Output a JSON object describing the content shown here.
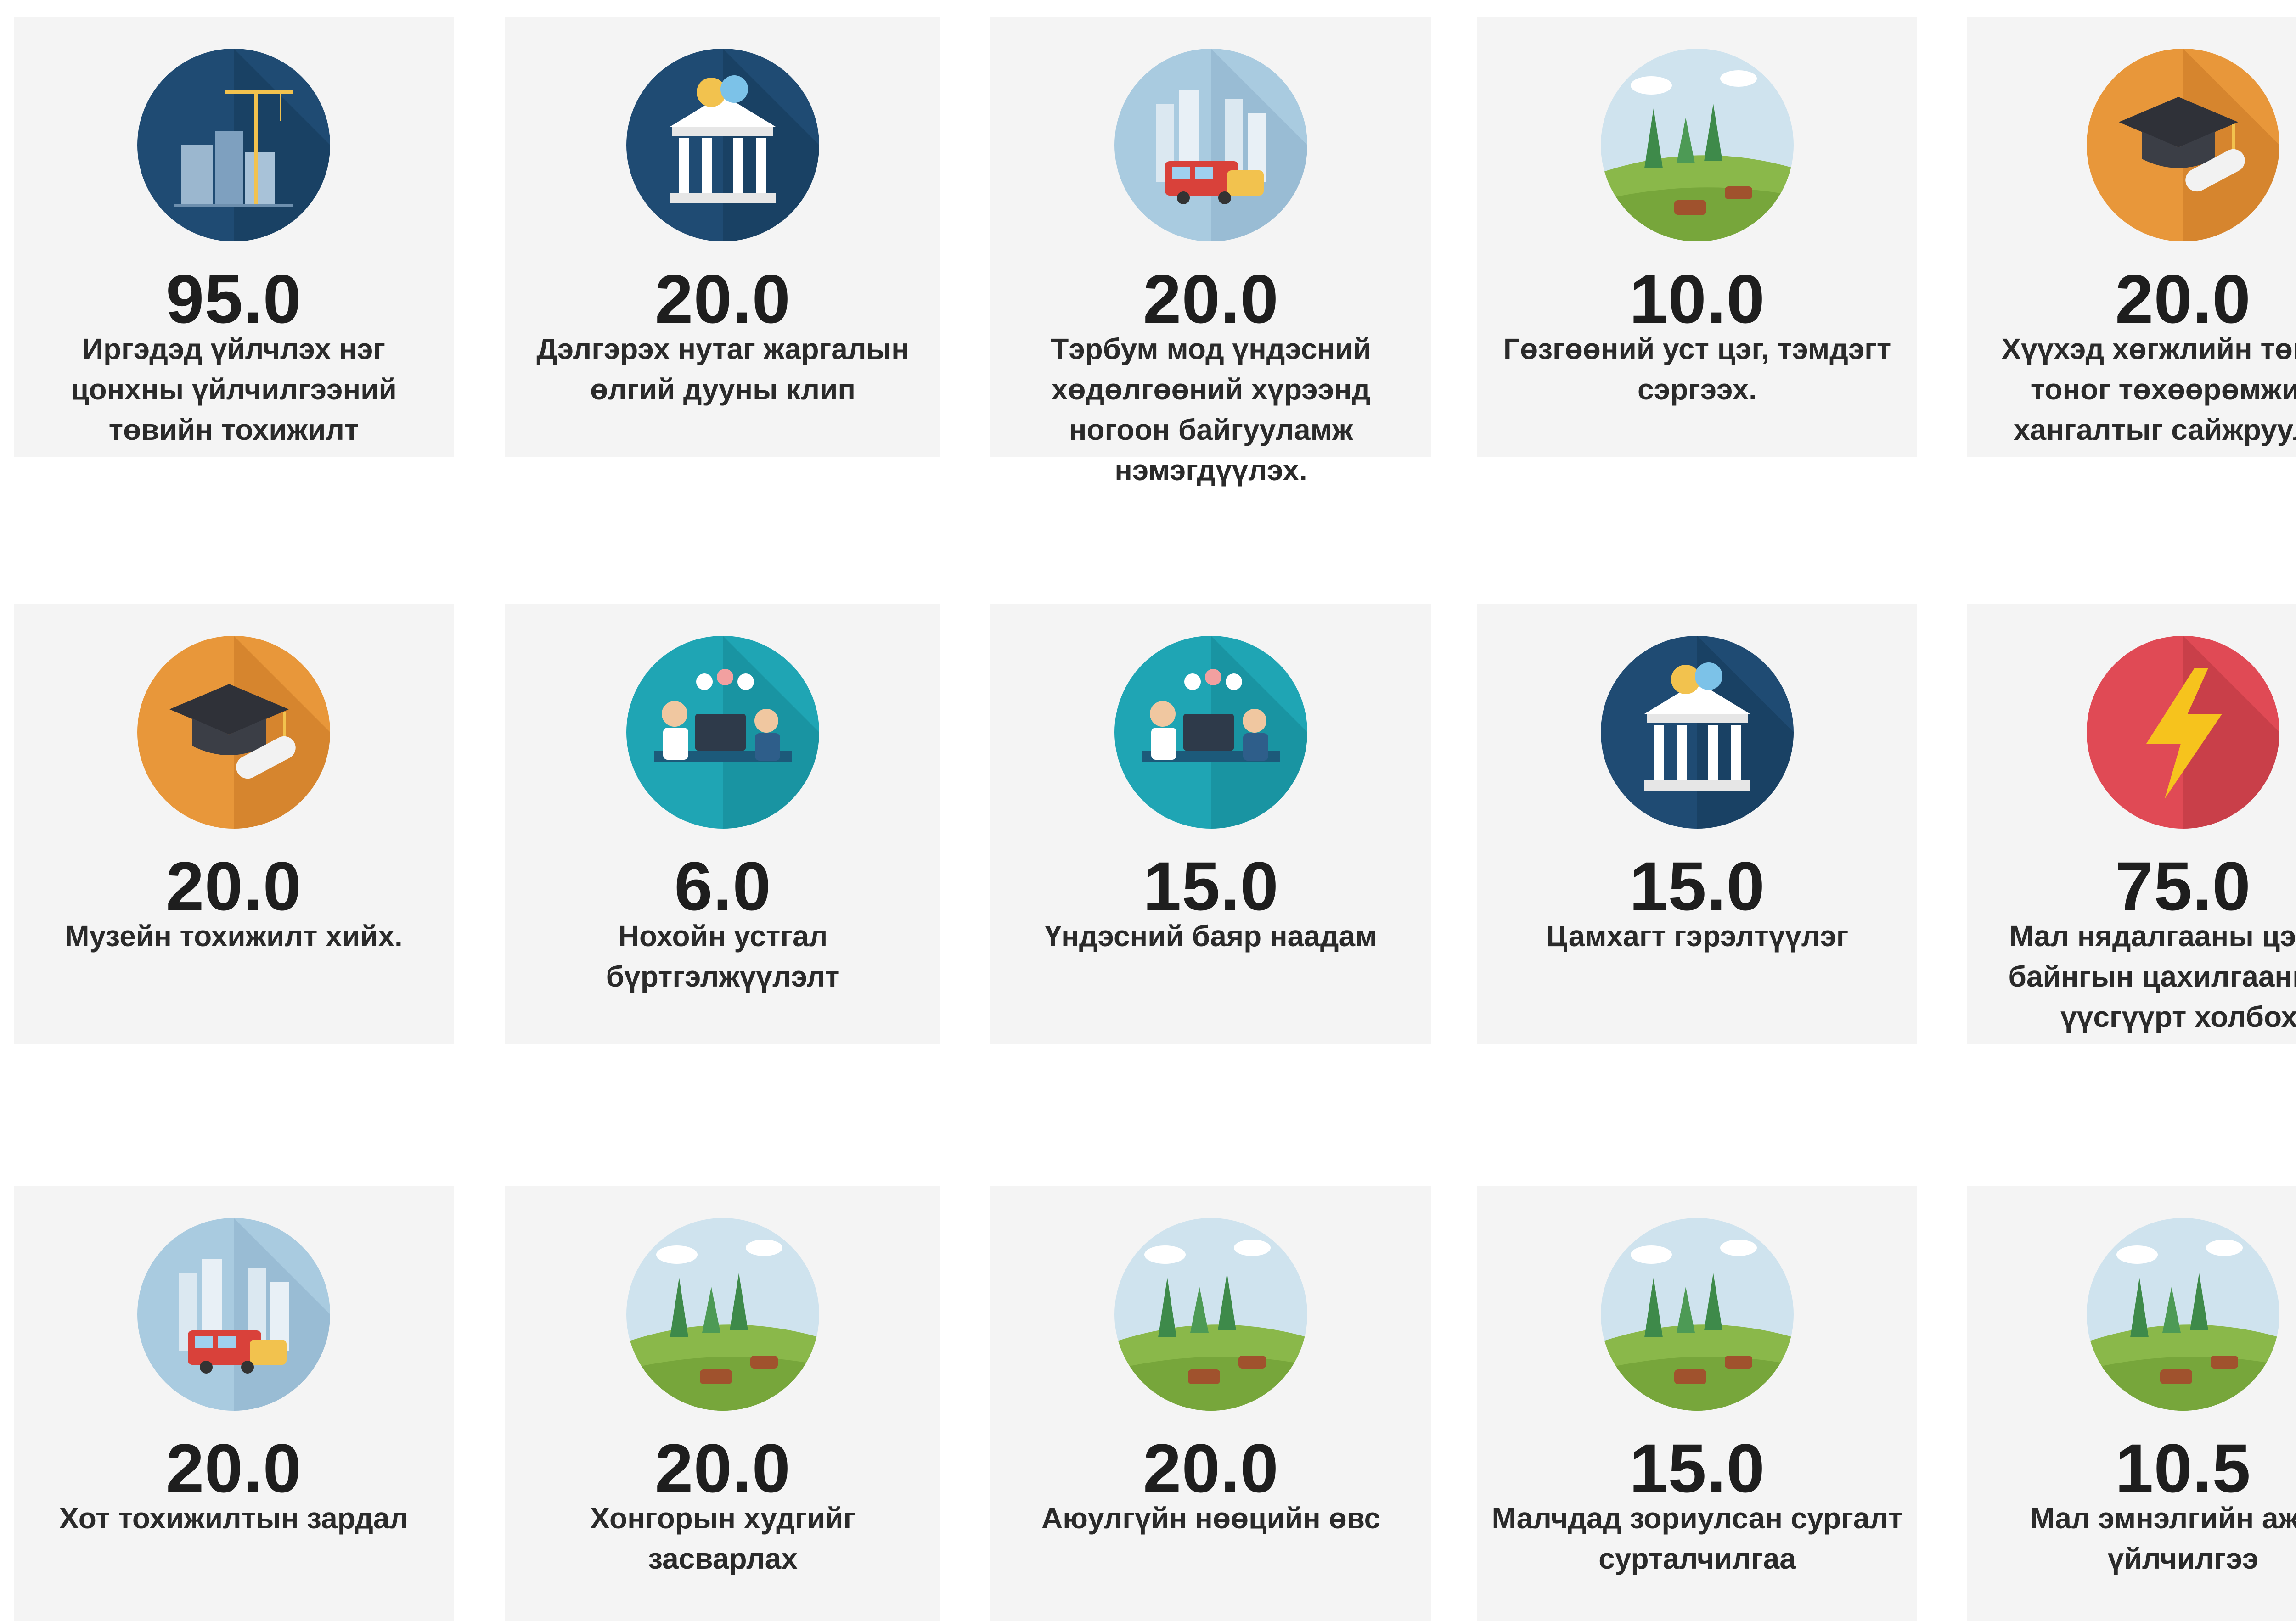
{
  "cards": [
    {
      "value": "95.0",
      "label": "Иргэдэд үйлчлэх нэг цонхны үйлчилгээний төвийн тохижилт",
      "icon": "construction-icon",
      "color": "#1f4b73"
    },
    {
      "value": "20.0",
      "label": "Дэлгэрэх нутаг жаргалын өлгий дууны клип",
      "icon": "theater-building-icon",
      "color": "#1f4b73"
    },
    {
      "value": "20.0",
      "label": "Тэрбум мод үндэсний хөдөлгөөний хүрээнд ногоон байгууламж нэмэгдүүлэх.",
      "icon": "city-transport-icon",
      "color": "#a9cbe0"
    },
    {
      "value": "10.0",
      "label": "Гөзгөөний уст цэг, тэмдэгт сэргээх.",
      "icon": "pasture-livestock-icon",
      "color": "#cfe3ee"
    },
    {
      "value": "20.0",
      "label": "Хүүхэд хөгжлийн төвийн тоног төхөөрөмжийн хангалтыг сайжруулах.",
      "icon": "graduation-cap-icon",
      "color": "#e8973a"
    },
    {
      "value": "20.0",
      "label": "Музейн тохижилт хийх.",
      "icon": "graduation-cap-icon",
      "color": "#e8973a"
    },
    {
      "value": "6.0",
      "label": "Нохойн устгал бүртгэлжүүлэлт",
      "icon": "office-workers-icon",
      "color": "#1fa5b4"
    },
    {
      "value": "15.0",
      "label": "Үндэсний баяр наадам",
      "icon": "office-workers-icon",
      "color": "#1fa5b4"
    },
    {
      "value": "15.0",
      "label": "Цамхагт гэрэлтүүлэг",
      "icon": "theater-building-icon",
      "color": "#1f4b73"
    },
    {
      "value": "75.0",
      "label": "Мал нядалгааны цэгийг байнгын цахилгааны эх үүсгүүрт холбох.",
      "icon": "lightning-icon",
      "color": "#e04a55"
    },
    {
      "value": "20.0",
      "label": "Хот тохижилтын зардал",
      "icon": "city-transport-icon",
      "color": "#a9cbe0"
    },
    {
      "value": "20.0",
      "label": "Хонгорын худгийг засварлах",
      "icon": "pasture-livestock-icon",
      "color": "#cfe3ee"
    },
    {
      "value": "20.0",
      "label": "Аюулгүйн нөөцийн өвс",
      "icon": "pasture-livestock-icon",
      "color": "#cfe3ee"
    },
    {
      "value": "15.0",
      "label": "Малчдад зориулсан сургалт сурталчилгаа",
      "icon": "pasture-livestock-icon",
      "color": "#cfe3ee"
    },
    {
      "value": "10.5",
      "label": "Мал эмнэлгийн ажил үйлчилгээ",
      "icon": "pasture-livestock-icon",
      "color": "#cfe3ee"
    }
  ]
}
